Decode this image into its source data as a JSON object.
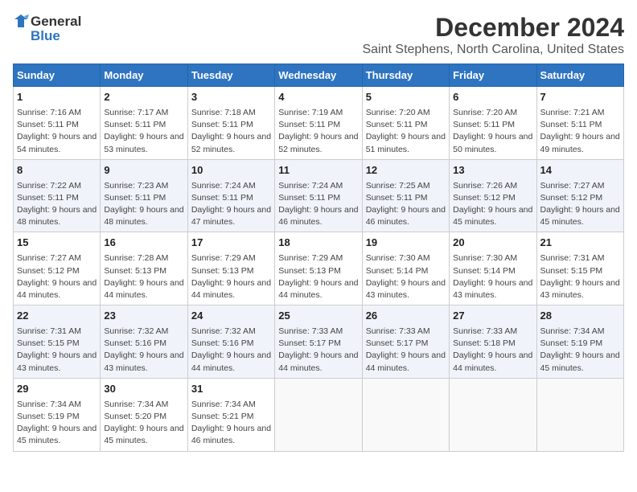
{
  "logo": {
    "line1": "General",
    "line2": "Blue"
  },
  "title": "December 2024",
  "subtitle": "Saint Stephens, North Carolina, United States",
  "weekdays": [
    "Sunday",
    "Monday",
    "Tuesday",
    "Wednesday",
    "Thursday",
    "Friday",
    "Saturday"
  ],
  "weeks": [
    [
      {
        "day": "1",
        "sunrise": "Sunrise: 7:16 AM",
        "sunset": "Sunset: 5:11 PM",
        "daylight": "Daylight: 9 hours and 54 minutes."
      },
      {
        "day": "2",
        "sunrise": "Sunrise: 7:17 AM",
        "sunset": "Sunset: 5:11 PM",
        "daylight": "Daylight: 9 hours and 53 minutes."
      },
      {
        "day": "3",
        "sunrise": "Sunrise: 7:18 AM",
        "sunset": "Sunset: 5:11 PM",
        "daylight": "Daylight: 9 hours and 52 minutes."
      },
      {
        "day": "4",
        "sunrise": "Sunrise: 7:19 AM",
        "sunset": "Sunset: 5:11 PM",
        "daylight": "Daylight: 9 hours and 52 minutes."
      },
      {
        "day": "5",
        "sunrise": "Sunrise: 7:20 AM",
        "sunset": "Sunset: 5:11 PM",
        "daylight": "Daylight: 9 hours and 51 minutes."
      },
      {
        "day": "6",
        "sunrise": "Sunrise: 7:20 AM",
        "sunset": "Sunset: 5:11 PM",
        "daylight": "Daylight: 9 hours and 50 minutes."
      },
      {
        "day": "7",
        "sunrise": "Sunrise: 7:21 AM",
        "sunset": "Sunset: 5:11 PM",
        "daylight": "Daylight: 9 hours and 49 minutes."
      }
    ],
    [
      {
        "day": "8",
        "sunrise": "Sunrise: 7:22 AM",
        "sunset": "Sunset: 5:11 PM",
        "daylight": "Daylight: 9 hours and 48 minutes."
      },
      {
        "day": "9",
        "sunrise": "Sunrise: 7:23 AM",
        "sunset": "Sunset: 5:11 PM",
        "daylight": "Daylight: 9 hours and 48 minutes."
      },
      {
        "day": "10",
        "sunrise": "Sunrise: 7:24 AM",
        "sunset": "Sunset: 5:11 PM",
        "daylight": "Daylight: 9 hours and 47 minutes."
      },
      {
        "day": "11",
        "sunrise": "Sunrise: 7:24 AM",
        "sunset": "Sunset: 5:11 PM",
        "daylight": "Daylight: 9 hours and 46 minutes."
      },
      {
        "day": "12",
        "sunrise": "Sunrise: 7:25 AM",
        "sunset": "Sunset: 5:11 PM",
        "daylight": "Daylight: 9 hours and 46 minutes."
      },
      {
        "day": "13",
        "sunrise": "Sunrise: 7:26 AM",
        "sunset": "Sunset: 5:12 PM",
        "daylight": "Daylight: 9 hours and 45 minutes."
      },
      {
        "day": "14",
        "sunrise": "Sunrise: 7:27 AM",
        "sunset": "Sunset: 5:12 PM",
        "daylight": "Daylight: 9 hours and 45 minutes."
      }
    ],
    [
      {
        "day": "15",
        "sunrise": "Sunrise: 7:27 AM",
        "sunset": "Sunset: 5:12 PM",
        "daylight": "Daylight: 9 hours and 44 minutes."
      },
      {
        "day": "16",
        "sunrise": "Sunrise: 7:28 AM",
        "sunset": "Sunset: 5:13 PM",
        "daylight": "Daylight: 9 hours and 44 minutes."
      },
      {
        "day": "17",
        "sunrise": "Sunrise: 7:29 AM",
        "sunset": "Sunset: 5:13 PM",
        "daylight": "Daylight: 9 hours and 44 minutes."
      },
      {
        "day": "18",
        "sunrise": "Sunrise: 7:29 AM",
        "sunset": "Sunset: 5:13 PM",
        "daylight": "Daylight: 9 hours and 44 minutes."
      },
      {
        "day": "19",
        "sunrise": "Sunrise: 7:30 AM",
        "sunset": "Sunset: 5:14 PM",
        "daylight": "Daylight: 9 hours and 43 minutes."
      },
      {
        "day": "20",
        "sunrise": "Sunrise: 7:30 AM",
        "sunset": "Sunset: 5:14 PM",
        "daylight": "Daylight: 9 hours and 43 minutes."
      },
      {
        "day": "21",
        "sunrise": "Sunrise: 7:31 AM",
        "sunset": "Sunset: 5:15 PM",
        "daylight": "Daylight: 9 hours and 43 minutes."
      }
    ],
    [
      {
        "day": "22",
        "sunrise": "Sunrise: 7:31 AM",
        "sunset": "Sunset: 5:15 PM",
        "daylight": "Daylight: 9 hours and 43 minutes."
      },
      {
        "day": "23",
        "sunrise": "Sunrise: 7:32 AM",
        "sunset": "Sunset: 5:16 PM",
        "daylight": "Daylight: 9 hours and 43 minutes."
      },
      {
        "day": "24",
        "sunrise": "Sunrise: 7:32 AM",
        "sunset": "Sunset: 5:16 PM",
        "daylight": "Daylight: 9 hours and 44 minutes."
      },
      {
        "day": "25",
        "sunrise": "Sunrise: 7:33 AM",
        "sunset": "Sunset: 5:17 PM",
        "daylight": "Daylight: 9 hours and 44 minutes."
      },
      {
        "day": "26",
        "sunrise": "Sunrise: 7:33 AM",
        "sunset": "Sunset: 5:17 PM",
        "daylight": "Daylight: 9 hours and 44 minutes."
      },
      {
        "day": "27",
        "sunrise": "Sunrise: 7:33 AM",
        "sunset": "Sunset: 5:18 PM",
        "daylight": "Daylight: 9 hours and 44 minutes."
      },
      {
        "day": "28",
        "sunrise": "Sunrise: 7:34 AM",
        "sunset": "Sunset: 5:19 PM",
        "daylight": "Daylight: 9 hours and 45 minutes."
      }
    ],
    [
      {
        "day": "29",
        "sunrise": "Sunrise: 7:34 AM",
        "sunset": "Sunset: 5:19 PM",
        "daylight": "Daylight: 9 hours and 45 minutes."
      },
      {
        "day": "30",
        "sunrise": "Sunrise: 7:34 AM",
        "sunset": "Sunset: 5:20 PM",
        "daylight": "Daylight: 9 hours and 45 minutes."
      },
      {
        "day": "31",
        "sunrise": "Sunrise: 7:34 AM",
        "sunset": "Sunset: 5:21 PM",
        "daylight": "Daylight: 9 hours and 46 minutes."
      },
      null,
      null,
      null,
      null
    ]
  ]
}
